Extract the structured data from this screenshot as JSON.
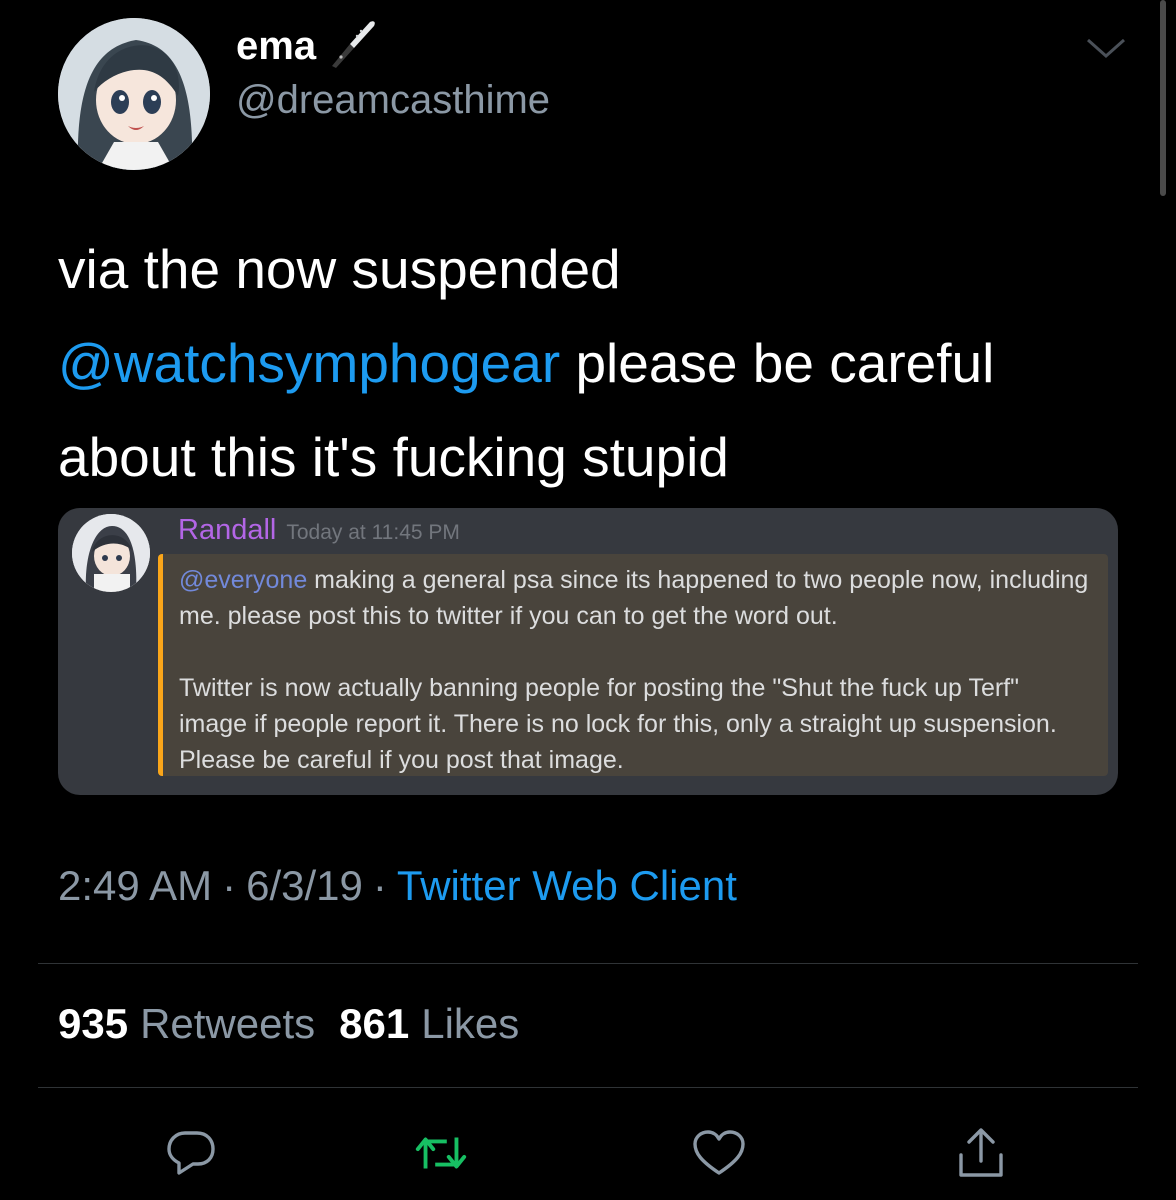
{
  "author": {
    "name": "ema",
    "handle": "@dreamcasthime",
    "name_emoji": "kitchen-knife-icon"
  },
  "tweet": {
    "text_before": "via the now suspended",
    "mention": "@watchsymphogear",
    "text_after": " please be careful about this it's fucking stupid"
  },
  "embed": {
    "username": "Randall",
    "timestamp": "Today at 11:45 PM",
    "mention": "@everyone",
    "line1": " making a general psa since its happened to two people now, including me. please post this to twitter if you can to get the word out.",
    "line2": "Twitter is now actually banning people for posting the \"Shut the fuck up Terf\" image if people report it. There is no lock for this, only a straight up suspension. Please be careful if you post that image."
  },
  "meta": {
    "time": "2:49 AM",
    "separator": "·",
    "date": "6/3/19",
    "client": "Twitter Web Client"
  },
  "stats": {
    "retweets_count": "935",
    "retweets_label": "Retweets",
    "likes_count": "861",
    "likes_label": "Likes"
  },
  "actions": {
    "reply_icon": "reply-icon",
    "retweet_icon": "retweet-icon",
    "like_icon": "heart-icon",
    "share_icon": "share-icon"
  },
  "colors": {
    "background": "#000000",
    "link": "#1d9bf0",
    "secondary_text": "#8b98a5",
    "retweet_green": "#17bf63",
    "embed_background": "#36393f",
    "embed_highlight": "#49443c",
    "embed_accent": "#faa61a",
    "embed_username": "#b366e6",
    "embed_mention": "#7289da"
  }
}
